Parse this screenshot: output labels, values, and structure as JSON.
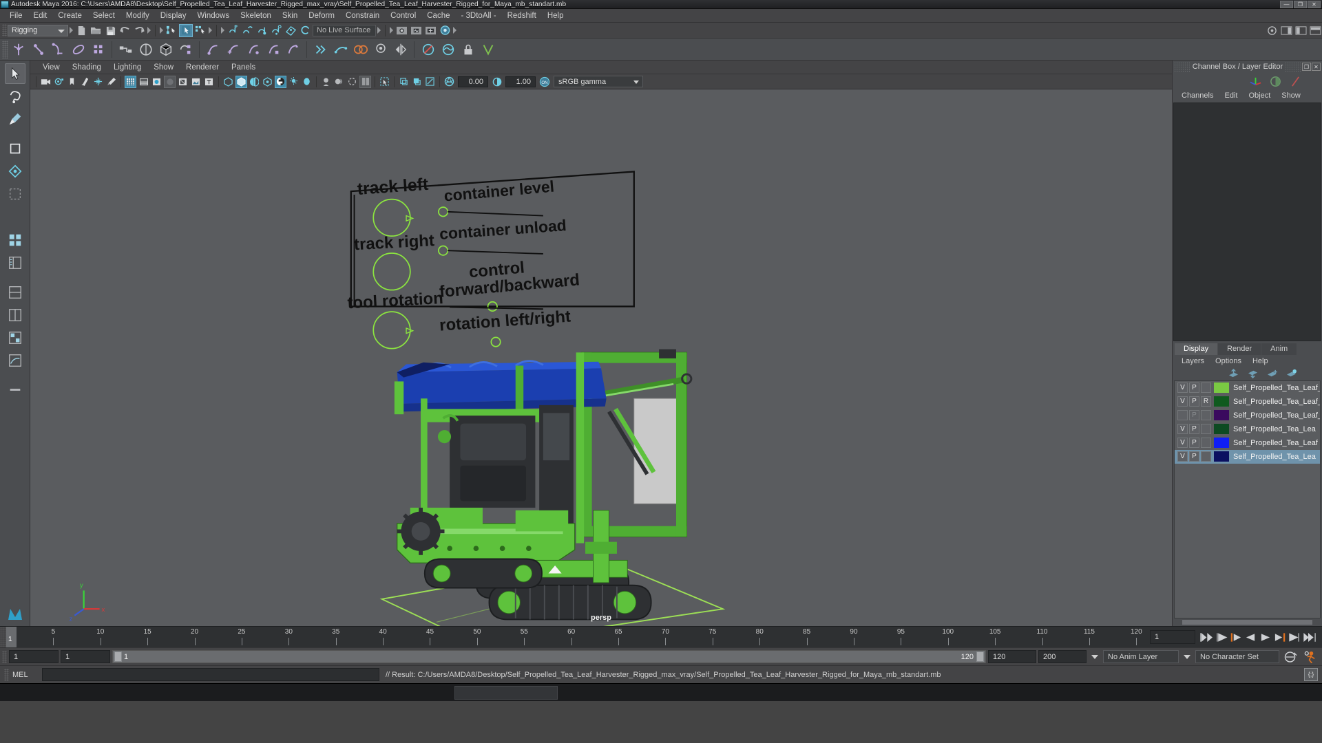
{
  "titlebar": {
    "text": "Autodesk Maya 2016: C:\\Users\\AMDA8\\Desktop\\Self_Propelled_Tea_Leaf_Harvester_Rigged_max_vray\\Self_Propelled_Tea_Leaf_Harvester_Rigged_for_Maya_mb_standart.mb",
    "minimize": "—",
    "maximize": "❐",
    "close": "✕"
  },
  "menubar": {
    "items": [
      "File",
      "Edit",
      "Create",
      "Select",
      "Modify",
      "Display",
      "Windows",
      "Skeleton",
      "Skin",
      "Deform",
      "Constrain",
      "Control",
      "Cache",
      "- 3DtoAll -",
      "Redshift",
      "Help"
    ]
  },
  "statusline": {
    "menuset": "Rigging",
    "live_surface": "No Live Surface"
  },
  "viewport_menu": {
    "items": [
      "View",
      "Shading",
      "Lighting",
      "Show",
      "Renderer",
      "Panels"
    ]
  },
  "viewport_icons": {
    "exposure_value": "0.00",
    "gamma_value": "1.00",
    "color_profile": "sRGB gamma",
    "toggle_on_label": "ON"
  },
  "viewport": {
    "camera_label": "persp",
    "axis_labels": {
      "x": "x",
      "y": "y",
      "z": "z"
    },
    "panel_labels": [
      "track left",
      "container level",
      "track right",
      "container unload",
      "tool rotation",
      "control",
      "forward/backward",
      "rotation left/right"
    ],
    "colors": {
      "background": "#5a5c5f",
      "machine_green": "#5ec23c",
      "machine_green_dark": "#3f8f28",
      "canopy_blue": "#1b3fb0",
      "canopy_blue_dark": "#16318c",
      "wire_green": "#8ce63f",
      "dark_mech": "#2e3033",
      "grid_green": "#9de055"
    }
  },
  "right_panel": {
    "title": "Channel Box / Layer Editor",
    "restore_btn": "❐",
    "close_btn": "✕",
    "menus": [
      "Channels",
      "Edit",
      "Object",
      "Show"
    ]
  },
  "layer_editor": {
    "tabs": [
      {
        "label": "Display",
        "active": true
      },
      {
        "label": "Render",
        "active": false
      },
      {
        "label": "Anim",
        "active": false
      }
    ],
    "menus": [
      "Layers",
      "Options",
      "Help"
    ],
    "layers": [
      {
        "v": "V",
        "p": "P",
        "r": "",
        "color": "#7ac943",
        "name": "Self_Propelled_Tea_Leaf_H",
        "selected": false,
        "dim": false
      },
      {
        "v": "V",
        "p": "P",
        "r": "R",
        "color": "#0f5a1e",
        "name": "Self_Propelled_Tea_Leaf_Harv",
        "selected": false,
        "dim": false
      },
      {
        "v": "",
        "p": "P",
        "r": "",
        "color": "#3a0a5e",
        "name": "Self_Propelled_Tea_Leaf_Harv",
        "selected": false,
        "dim": true
      },
      {
        "v": "V",
        "p": "P",
        "r": "",
        "color": "#0d4a22",
        "name": "Self_Propelled_Tea_Lea",
        "selected": false,
        "dim": false
      },
      {
        "v": "V",
        "p": "P",
        "r": "",
        "color": "#0f1ef5",
        "name": "Self_Propelled_Tea_Leaf",
        "selected": false,
        "dim": false
      },
      {
        "v": "V",
        "p": "P",
        "r": "",
        "color": "#0b1060",
        "name": "Self_Propelled_Tea_Lea",
        "selected": true,
        "dim": false
      }
    ]
  },
  "timeline": {
    "current_frame": "1",
    "ticks": [
      5,
      10,
      15,
      20,
      25,
      30,
      35,
      40,
      45,
      50,
      55,
      60,
      65,
      70,
      75,
      80,
      85,
      90,
      95,
      100,
      105,
      110,
      115,
      120
    ],
    "playhead_label": "1",
    "frame_field": "1"
  },
  "range": {
    "start": "1",
    "end": "1",
    "slider_start": "1",
    "slider_end": "120",
    "playback_end": "120",
    "anim_end": "200",
    "anim_layer": "No Anim Layer",
    "character_set": "No Character Set"
  },
  "command_line": {
    "label": "MEL",
    "input_value": "",
    "result": "// Result: C:/Users/AMDA8/Desktop/Self_Propelled_Tea_Leaf_Harvester_Rigged_max_vray/Self_Propelled_Tea_Leaf_Harvester_Rigged_for_Maya_mb_standart.mb",
    "script_editor_btn": "{;}"
  }
}
